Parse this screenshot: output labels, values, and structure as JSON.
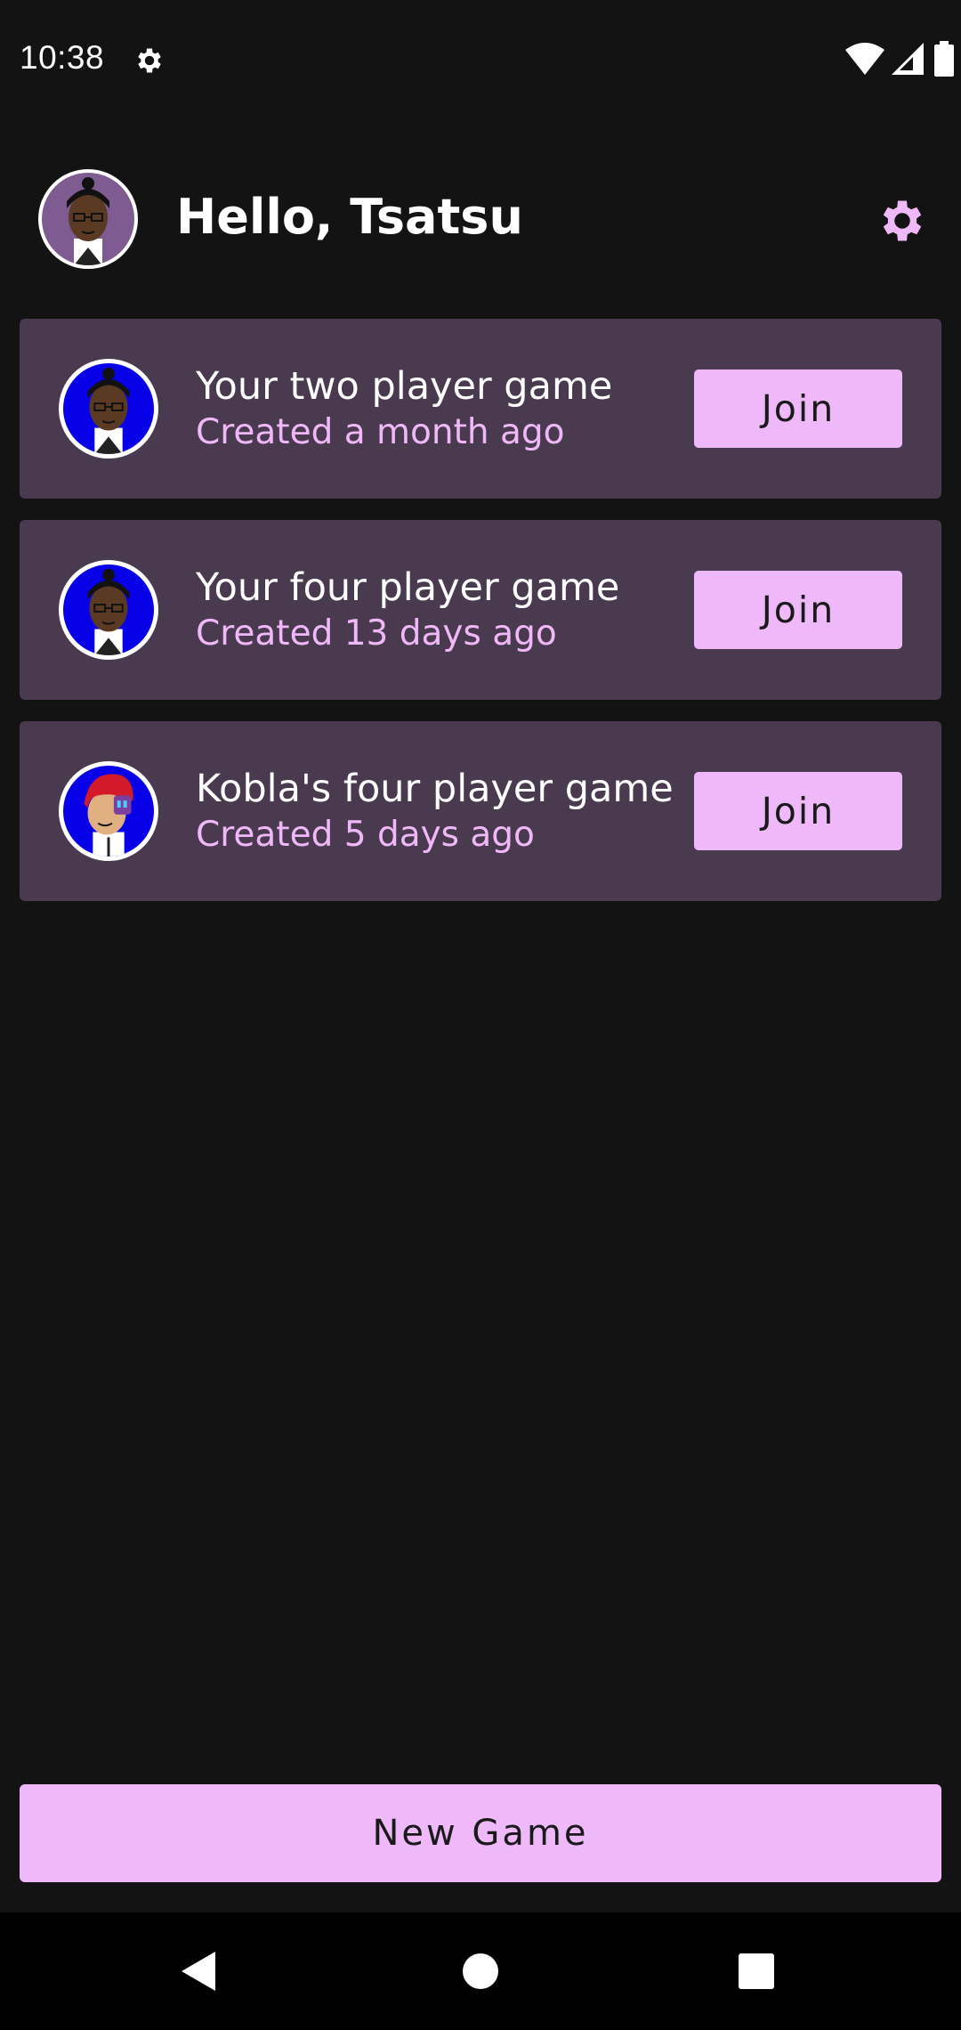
{
  "status_bar": {
    "time": "10:38",
    "icons": [
      "settings-icon",
      "wifi-icon",
      "cell-signal-icon",
      "battery-icon"
    ]
  },
  "header": {
    "greeting": "Hello, Tsatsu",
    "settings_icon": "gear-icon"
  },
  "games": [
    {
      "title": "Your two player game",
      "subtitle": "Created a month ago",
      "button": "Join",
      "avatar": "tsatsu"
    },
    {
      "title": "Your four player game",
      "subtitle": "Created 13 days ago",
      "button": "Join",
      "avatar": "tsatsu"
    },
    {
      "title": "Kobla's four player game",
      "subtitle": "Created 5 days ago",
      "button": "Join",
      "avatar": "kobla"
    }
  ],
  "new_game_button": "New Game",
  "nav_bar": {
    "buttons": [
      "back-icon",
      "home-icon",
      "recents-icon"
    ]
  },
  "colors": {
    "background": "#131313",
    "card": "#4a3a4f",
    "accent": "#efb8f9",
    "subtitle": "#f0b8f8",
    "avatar_bg_blue": "#0800e6",
    "avatar_bg_purple": "#7e5b90"
  }
}
